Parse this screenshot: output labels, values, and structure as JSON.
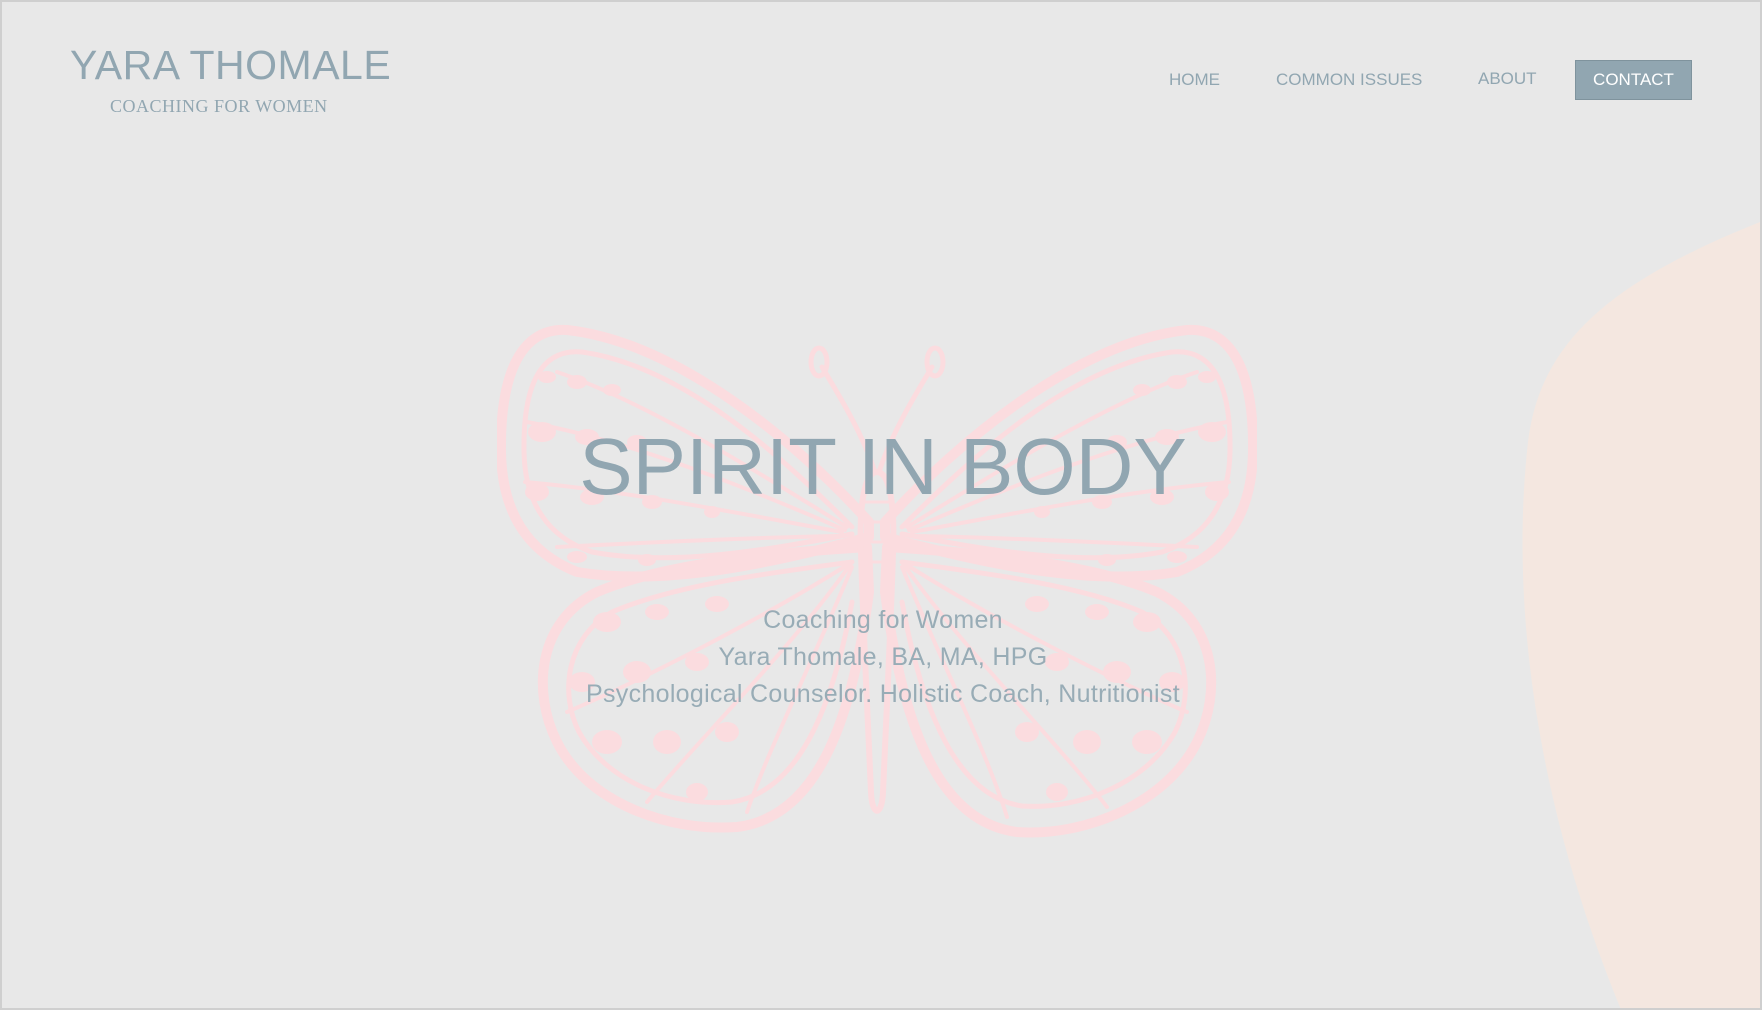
{
  "brand": {
    "name": "YARA THOMALE",
    "tagline": "COACHING FOR WOMEN"
  },
  "nav": {
    "items": [
      {
        "label": "HOME"
      },
      {
        "label": "COMMON ISSUES"
      },
      {
        "label": "ABOUT"
      },
      {
        "label": "CONTACT"
      }
    ]
  },
  "hero": {
    "title": "SPIRIT IN BODY",
    "lines": [
      "Coaching for Women",
      "Yara Thomale, BA, MA, HPG",
      "Psychological Counselor. Holistic Coach, Nutritionist"
    ]
  },
  "colors": {
    "background": "#e8e8e8",
    "accent": "#91a6b1",
    "butterfly": "#fbdcdf",
    "blob": "#f4e7e0"
  },
  "icons": {
    "hero_graphic": "butterfly-icon"
  }
}
